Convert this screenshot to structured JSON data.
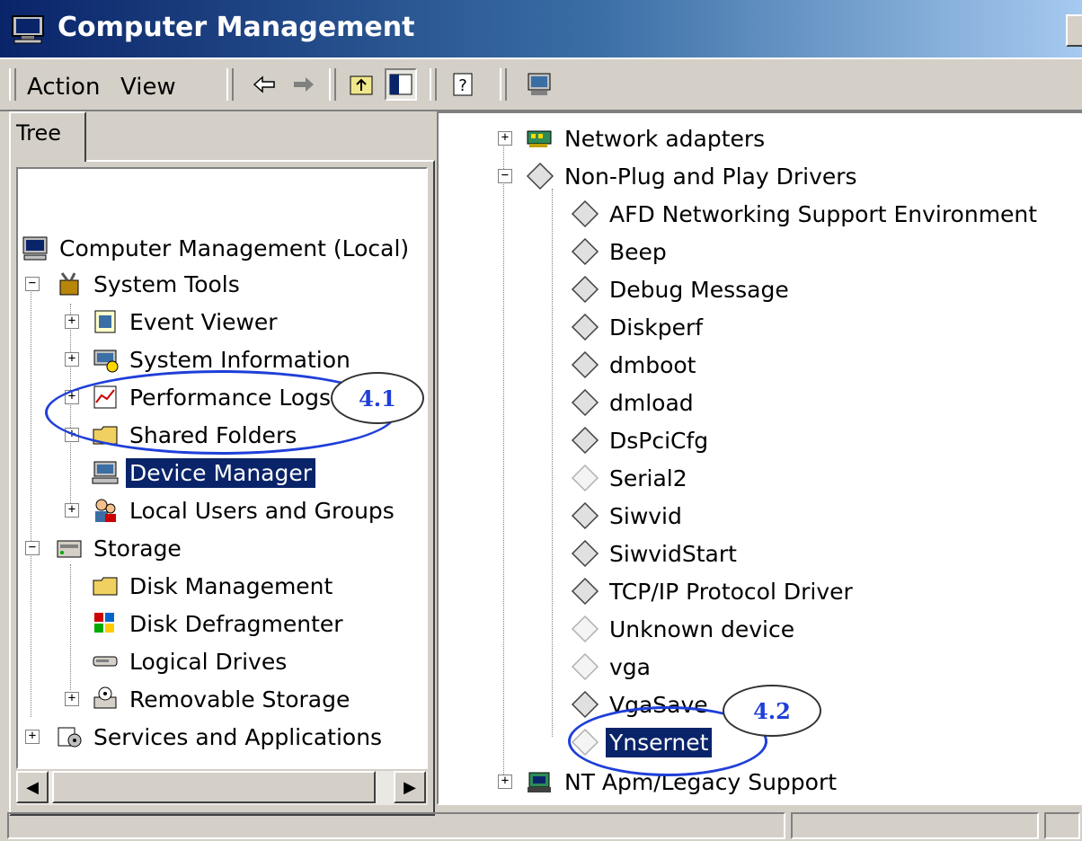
{
  "window": {
    "title": "Computer Management"
  },
  "menu": {
    "action": "Action",
    "view": "View"
  },
  "toolbar": {
    "buttons": [
      "back-arrow-icon",
      "forward-arrow-icon",
      "up-folder-icon",
      "show-tree-icon",
      "help-icon",
      "computer-icon"
    ]
  },
  "left": {
    "tab": "Tree",
    "items": [
      {
        "label": "Computer Management (Local)",
        "icon": "computer-icon"
      },
      {
        "label": "System Tools",
        "icon": "tools-icon"
      },
      {
        "label": "Event Viewer",
        "icon": "event-viewer-icon"
      },
      {
        "label": "System Information",
        "icon": "system-info-icon"
      },
      {
        "label": "Performance Logs and Ale",
        "icon": "performance-icon"
      },
      {
        "label": "Shared Folders",
        "icon": "shared-folder-icon"
      },
      {
        "label": "Device Manager",
        "icon": "device-manager-icon",
        "selected": true
      },
      {
        "label": "Local Users and Groups",
        "icon": "users-icon"
      },
      {
        "label": "Storage",
        "icon": "storage-icon"
      },
      {
        "label": "Disk Management",
        "icon": "disk-icon"
      },
      {
        "label": "Disk Defragmenter",
        "icon": "defrag-icon"
      },
      {
        "label": "Logical Drives",
        "icon": "drive-icon"
      },
      {
        "label": "Removable Storage",
        "icon": "removable-storage-icon"
      },
      {
        "label": "Services and Applications",
        "icon": "services-icon"
      }
    ]
  },
  "right": {
    "items": [
      {
        "label": "Network adapters",
        "icon": "network-card-icon"
      },
      {
        "label": "Non-Plug and Play Drivers",
        "icon": "driver-icon"
      },
      {
        "label": "AFD Networking Support Environment",
        "icon": "driver-icon"
      },
      {
        "label": "Beep",
        "icon": "driver-icon"
      },
      {
        "label": "Debug Message",
        "icon": "driver-icon"
      },
      {
        "label": "Diskperf",
        "icon": "driver-icon"
      },
      {
        "label": "dmboot",
        "icon": "driver-icon"
      },
      {
        "label": "dmload",
        "icon": "driver-icon"
      },
      {
        "label": "DsPciCfg",
        "icon": "driver-icon"
      },
      {
        "label": "Serial2",
        "icon": "driver-faded-icon"
      },
      {
        "label": "Siwvid",
        "icon": "driver-icon"
      },
      {
        "label": "SiwvidStart",
        "icon": "driver-icon"
      },
      {
        "label": "TCP/IP Protocol Driver",
        "icon": "driver-icon"
      },
      {
        "label": "Unknown device",
        "icon": "driver-faded-icon"
      },
      {
        "label": "vga",
        "icon": "driver-faded-icon"
      },
      {
        "label": "VgaSave",
        "icon": "driver-icon"
      },
      {
        "label": "Ynsernet",
        "icon": "driver-faded-icon",
        "selected": true
      },
      {
        "label": "NT Apm/Legacy Support",
        "icon": "apm-icon"
      }
    ]
  },
  "callouts": {
    "first": "4.1",
    "second": "4.2"
  },
  "colors": {
    "title_start": "#0a246a",
    "selection": "#0a246a",
    "callout": "#1f3fd8"
  }
}
